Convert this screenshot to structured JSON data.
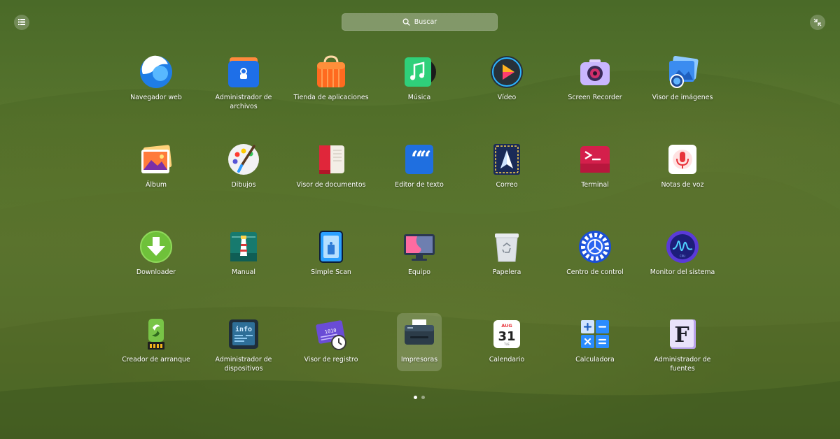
{
  "search": {
    "label": "Buscar",
    "icon": "search-icon"
  },
  "toolbar": {
    "left_icon": "grid-view-icon",
    "right_icon": "exit-fullscreen-icon"
  },
  "apps": [
    {
      "label": "Navegador web",
      "icon": "browser-icon"
    },
    {
      "label": "Administrador de archivos",
      "icon": "file-manager-icon"
    },
    {
      "label": "Tienda de aplicaciones",
      "icon": "app-store-icon"
    },
    {
      "label": "Música",
      "icon": "music-icon"
    },
    {
      "label": "Vídeo",
      "icon": "video-play-icon"
    },
    {
      "label": "Screen Recorder",
      "icon": "camera-icon"
    },
    {
      "label": "Visor de imágenes",
      "icon": "image-viewer-icon"
    },
    {
      "label": "Álbum",
      "icon": "photo-album-icon"
    },
    {
      "label": "Dibujos",
      "icon": "paint-palette-icon"
    },
    {
      "label": "Visor de documentos",
      "icon": "book-icon"
    },
    {
      "label": "Editor de texto",
      "icon": "quote-icon"
    },
    {
      "label": "Correo",
      "icon": "mail-send-icon"
    },
    {
      "label": "Terminal",
      "icon": "terminal-icon"
    },
    {
      "label": "Notas de voz",
      "icon": "microphone-icon"
    },
    {
      "label": "Downloader",
      "icon": "download-icon"
    },
    {
      "label": "Manual",
      "icon": "lighthouse-icon"
    },
    {
      "label": "Simple Scan",
      "icon": "scanner-icon"
    },
    {
      "label": "Equipo",
      "icon": "monitor-icon"
    },
    {
      "label": "Papelera",
      "icon": "trash-icon"
    },
    {
      "label": "Centro de control",
      "icon": "gear-icon"
    },
    {
      "label": "Monitor del sistema",
      "icon": "system-monitor-icon"
    },
    {
      "label": "Creador de arranque",
      "icon": "usb-drive-icon"
    },
    {
      "label": "Administrador de dispositivos",
      "icon": "device-info-icon"
    },
    {
      "label": "Visor de registro",
      "icon": "log-clock-icon"
    },
    {
      "label": "Impresoras",
      "icon": "printer-icon"
    },
    {
      "label": "Calendario",
      "icon": "calendar-icon"
    },
    {
      "label": "Calculadora",
      "icon": "calculator-icon"
    },
    {
      "label": "Administrador de fuentes",
      "icon": "font-icon"
    }
  ],
  "calendar_icon": {
    "month": "AUG",
    "day": "31",
    "weekday": "TUE"
  },
  "device_icon": {
    "text": "info"
  },
  "log_icon": {
    "text": "1010"
  },
  "font_icon": {
    "letter": "F"
  },
  "selected_app": "Impresoras",
  "pagination": {
    "pages": 2,
    "current": 1
  }
}
